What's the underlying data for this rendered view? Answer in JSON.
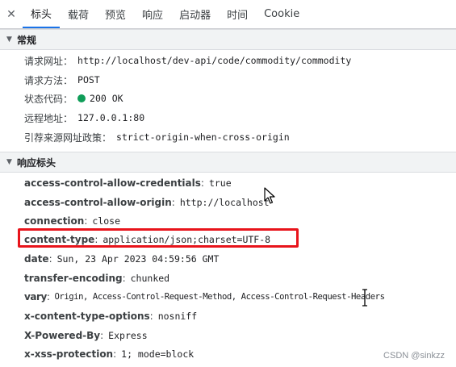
{
  "tabs": [
    {
      "label": "标头",
      "active": true
    },
    {
      "label": "载荷",
      "active": false
    },
    {
      "label": "预览",
      "active": false
    },
    {
      "label": "响应",
      "active": false
    },
    {
      "label": "启动器",
      "active": false
    },
    {
      "label": "时间",
      "active": false
    },
    {
      "label": "Cookie",
      "active": false
    }
  ],
  "close_glyph": "✕",
  "general": {
    "title": "常规",
    "rows": [
      {
        "key": "请求网址",
        "value": "http://localhost/dev-api/code/commodity/commodity"
      },
      {
        "key": "请求方法",
        "value": "POST"
      },
      {
        "key": "状态代码",
        "value": "200 OK",
        "status_color": "#0f9d58"
      },
      {
        "key": "远程地址",
        "value": "127.0.0.1:80"
      },
      {
        "key": "引荐来源网址政策",
        "value": "strict-origin-when-cross-origin"
      }
    ]
  },
  "response_headers": {
    "title": "响应标头",
    "rows": [
      {
        "key": "access-control-allow-credentials",
        "value": "true"
      },
      {
        "key": "access-control-allow-origin",
        "value": "http://localhost"
      },
      {
        "key": "connection",
        "value": "close"
      },
      {
        "key": "content-type",
        "value": "application/json;charset=UTF-8",
        "highlighted": true
      },
      {
        "key": "date",
        "value": "Sun, 23 Apr 2023 04:59:56 GMT"
      },
      {
        "key": "transfer-encoding",
        "value": "chunked"
      },
      {
        "key": "vary",
        "value": "Origin, Access-Control-Request-Method, Access-Control-Request-Headers"
      },
      {
        "key": "x-content-type-options",
        "value": "nosniff"
      },
      {
        "key": "X-Powered-By",
        "value": "Express"
      },
      {
        "key": "x-xss-protection",
        "value": "1; mode=block"
      }
    ]
  },
  "colon_cn": "：",
  "colon_en": ":",
  "watermark": "CSDN @sinkzz",
  "colors": {
    "highlight": "#e8141b",
    "active_tab": "#1a73e8",
    "status_ok": "#0f9d58"
  }
}
